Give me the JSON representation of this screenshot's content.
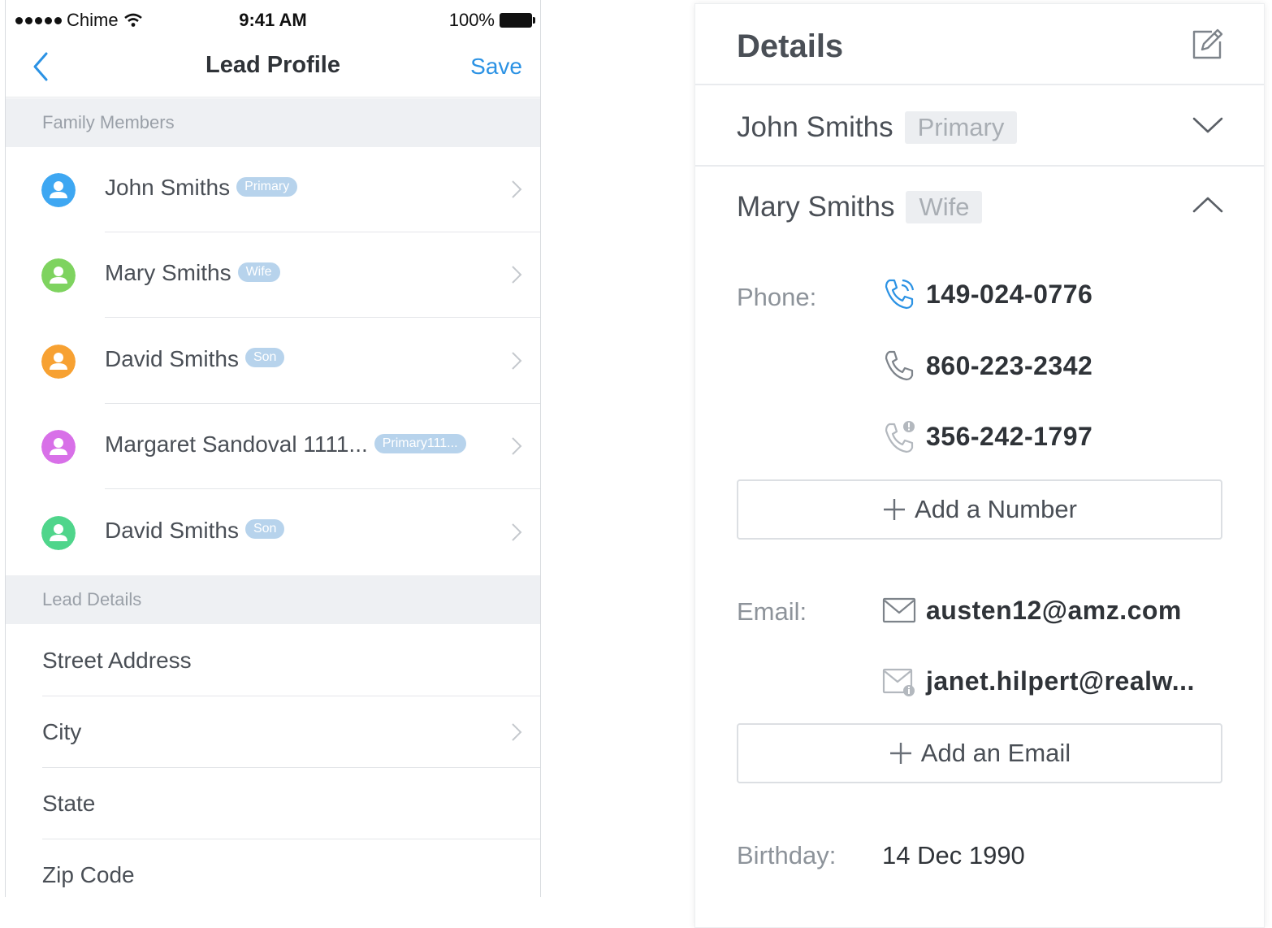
{
  "status_bar": {
    "carrier": "Chime",
    "time": "9:41 AM",
    "battery": "100%"
  },
  "nav": {
    "title": "Lead Profile",
    "save_label": "Save"
  },
  "family": {
    "section_label": "Family Members",
    "members": [
      {
        "name": "John Smiths",
        "tag": "Primary",
        "avatar_color": "#3ea7f2"
      },
      {
        "name": "Mary Smiths",
        "tag": "Wife",
        "avatar_color": "#7ed35f"
      },
      {
        "name": "David Smiths",
        "tag": "Son",
        "avatar_color": "#f7a132"
      },
      {
        "name": "Margaret Sandoval 1111...",
        "tag": "Primary111...",
        "avatar_color": "#d870e8"
      },
      {
        "name": "David Smiths",
        "tag": "Son",
        "avatar_color": "#4fd58b"
      }
    ]
  },
  "lead_details": {
    "section_label": "Lead Details",
    "fields": [
      {
        "label": "Street Address"
      },
      {
        "label": "City"
      },
      {
        "label": "State"
      },
      {
        "label": "Zip Code"
      }
    ]
  },
  "details": {
    "title": "Details",
    "persons": [
      {
        "name": "John Smiths",
        "tag": "Primary",
        "expanded": false
      },
      {
        "name": "Mary Smiths",
        "tag": "Wife",
        "expanded": true
      }
    ],
    "phone_label": "Phone:",
    "phones": [
      {
        "number": "149-024-0776",
        "icon": "phone-calling-icon"
      },
      {
        "number": "860-223-2342",
        "icon": "phone-icon"
      },
      {
        "number": "356-242-1797",
        "icon": "phone-alert-icon"
      }
    ],
    "add_number_label": "Add a Number",
    "email_label": "Email:",
    "emails": [
      {
        "address": "austen12@amz.com",
        "icon": "mail-icon"
      },
      {
        "address": "janet.hilpert@realw...",
        "icon": "mail-alert-icon"
      }
    ],
    "add_email_label": "Add an Email",
    "birthday_label": "Birthday:",
    "birthday_value": "14 Dec 1990"
  },
  "colors": {
    "accent": "#2b92e4",
    "tag_pill": "#b7d3ec",
    "section_bg": "#eef0f3"
  }
}
